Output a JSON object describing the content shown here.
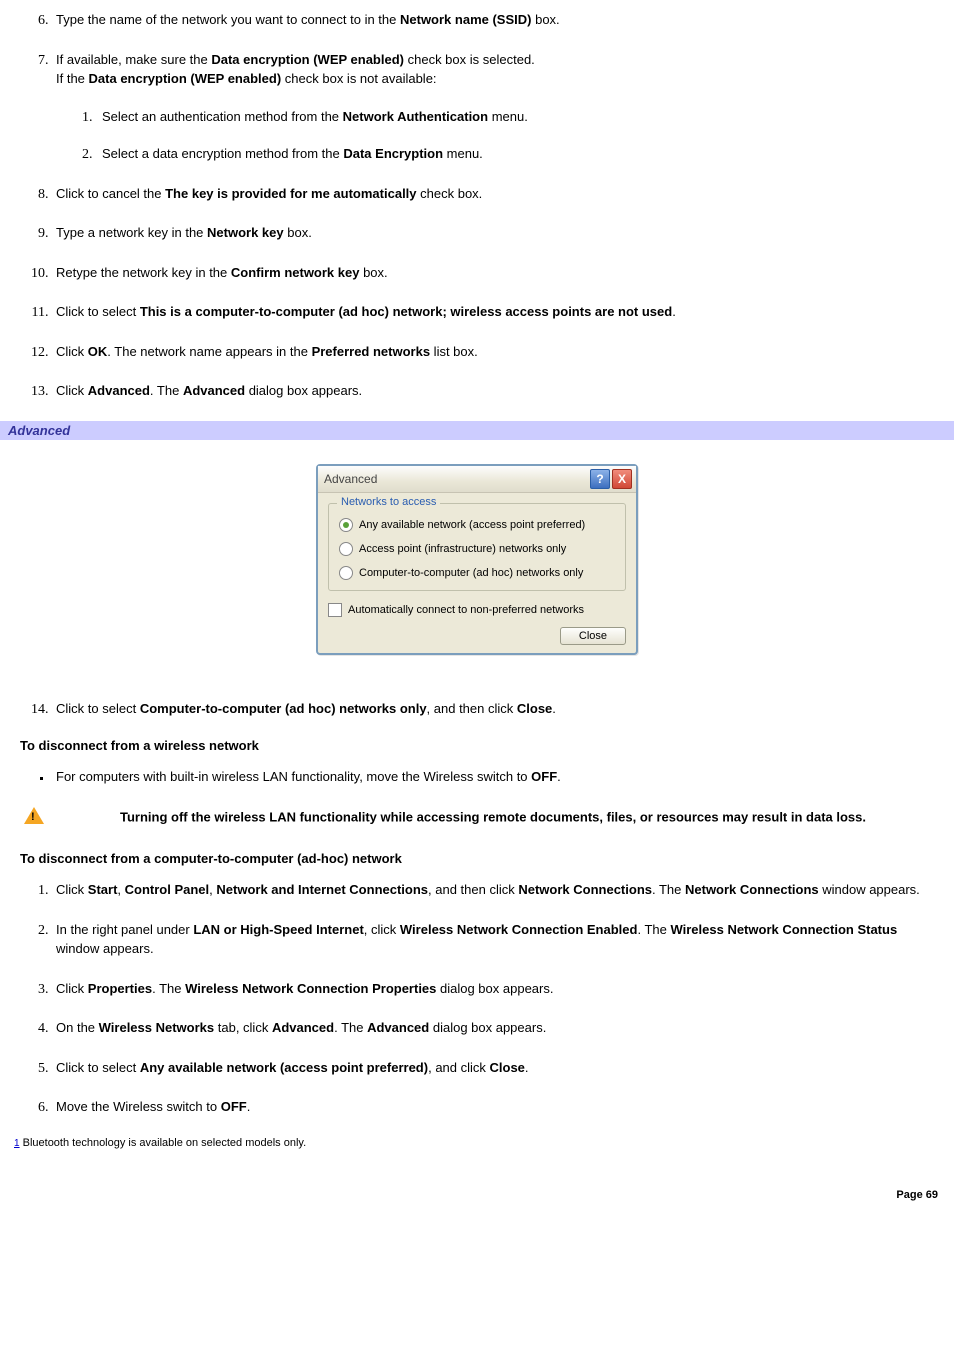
{
  "steps_a": {
    "6": {
      "pre": "Type the name of the network you want to connect to in the ",
      "b1": "Network name (SSID)",
      "post": " box."
    },
    "7": {
      "line1_pre": "If available, make sure the ",
      "line1_b": "Data encryption (WEP enabled)",
      "line1_post": " check box is selected.",
      "line2_pre": "If the ",
      "line2_b": "Data encryption (WEP enabled)",
      "line2_post": " check box is not available:",
      "sub1_pre": "Select an authentication method from the ",
      "sub1_b": "Network Authentication",
      "sub1_post": " menu.",
      "sub2_pre": "Select a data encryption method from the ",
      "sub2_b": "Data Encryption",
      "sub2_post": " menu."
    },
    "8": {
      "pre": "Click to cancel the ",
      "b1": "The key is provided for me automatically",
      "post": " check box."
    },
    "9": {
      "pre": "Type a network key in the ",
      "b1": "Network key",
      "post": " box."
    },
    "10": {
      "pre": "Retype the network key in the ",
      "b1": "Confirm network key",
      "post": " box."
    },
    "11": {
      "pre": "Click to select ",
      "b1": "This is a computer-to-computer (ad hoc) network; wireless access points are not used",
      "post": "."
    },
    "12": {
      "pre": "Click ",
      "b1": "OK",
      "mid": ". The network name appears in the ",
      "b2": "Preferred networks",
      "post": " list box."
    },
    "13": {
      "pre": "Click ",
      "b1": "Advanced",
      "mid": ". The ",
      "b2": "Advanced",
      "post": " dialog box appears."
    }
  },
  "section_bar": "Advanced",
  "dialog": {
    "title": "Advanced",
    "group": "Networks to access",
    "opt1": "Any available network (access point preferred)",
    "opt2": "Access point (infrastructure) networks only",
    "opt3": "Computer-to-computer (ad hoc) networks only",
    "check": "Automatically connect to non-preferred networks",
    "close": "Close",
    "help": "?",
    "x": "X"
  },
  "step14": {
    "pre": "Click to select ",
    "b1": "Computer-to-computer (ad hoc) networks only",
    "mid": ", and then click ",
    "b2": "Close",
    "post": "."
  },
  "heading_disconnect_wireless": "To disconnect from a wireless network",
  "bullet_disconnect": {
    "pre": "For computers with built-in wireless LAN functionality, move the Wireless switch to ",
    "b1": "OFF",
    "post": "."
  },
  "warning": "Turning off the wireless LAN functionality while accessing remote documents, files, or resources may result in data loss.",
  "heading_disconnect_adhoc": "To disconnect from a computer-to-computer (ad-hoc) network",
  "steps_b": {
    "1": {
      "p1": "Click ",
      "b1": "Start",
      "p2": ", ",
      "b2": "Control Panel",
      "p3": ", ",
      "b3": "Network and Internet Connections",
      "p4": ", and then click ",
      "b4": "Network Connections",
      "p5": ". The ",
      "b5": "Network Connections",
      "p6": " window appears."
    },
    "2": {
      "p1": "In the right panel under ",
      "b1": "LAN or High-Speed Internet",
      "p2": ", click ",
      "b2": "Wireless Network Connection Enabled",
      "p3": ". The ",
      "b3": "Wireless Network Connection Status",
      "p4": " window appears."
    },
    "3": {
      "p1": "Click ",
      "b1": "Properties",
      "p2": ". The ",
      "b2": "Wireless Network Connection Properties",
      "p3": " dialog box appears."
    },
    "4": {
      "p1": "On the ",
      "b1": "Wireless Networks",
      "p2": " tab, click ",
      "b2": "Advanced",
      "p3": ". The ",
      "b3": "Advanced",
      "p4": " dialog box appears."
    },
    "5": {
      "p1": "Click to select ",
      "b1": "Any available network (access point preferred)",
      "p2": ", and click ",
      "b2": "Close",
      "p3": "."
    },
    "6": {
      "p1": "Move the Wireless switch to ",
      "b1": "OFF",
      "p2": "."
    }
  },
  "footnote_ref": "1",
  "footnote_text": " Bluetooth technology is available on selected models only.",
  "page_number": "Page 69"
}
